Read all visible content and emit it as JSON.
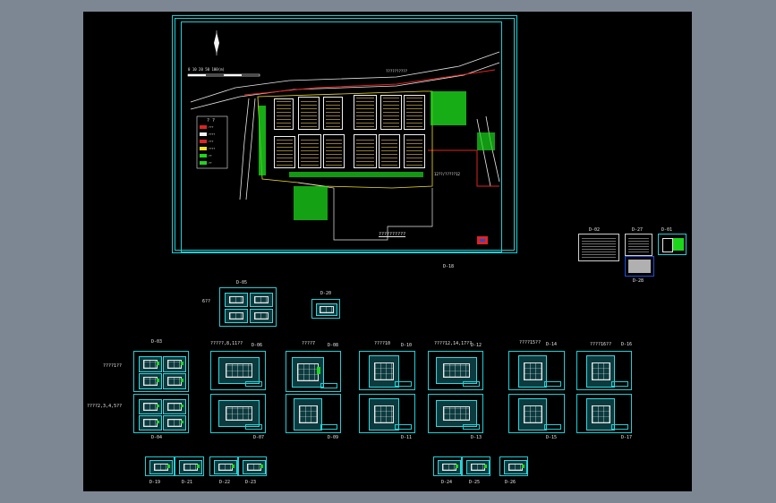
{
  "main_sheet": {
    "scale_label": "0 10 20       50        100(m)",
    "road_label": "??????????",
    "legend_title": "? ?",
    "legend_items": [
      "???",
      "????",
      "???",
      "????",
      "??",
      "??",
      "???"
    ],
    "road_label_bottom": "12??/?????12",
    "bottom_caption": "??????????",
    "sheet_code": "D-18"
  },
  "side_sheets": {
    "d02": "D-02",
    "d27": "D-27",
    "d01": "D-01",
    "d28": "D-28"
  },
  "mid_sheets": {
    "d05": "D-05",
    "d05_note": "6??",
    "d20": "D-20"
  },
  "row_labels": {
    "group1_note_a": "????1??",
    "group1_note_b": "????2,3,4,5??",
    "d03": "D-03",
    "d04": "D-04",
    "g2": "?????,8,11??",
    "d06": "D-06",
    "d07": "D-07",
    "g3": "????7",
    "d08": "D-08",
    "d09": "D-09",
    "g4": "????10",
    "d10": "D-10",
    "d11": "D-11",
    "g5": "????12,14,17??",
    "d12": "D-12",
    "d13": "D-13",
    "g6": "????15??",
    "d14": "D-14",
    "d15": "D-15",
    "g7": "????16??",
    "d16": "D-16",
    "d17": "D-17"
  },
  "bottom_labels": {
    "d19": "D-19",
    "d21": "D-21",
    "d22": "D-22",
    "d23": "D-23",
    "d24": "D-24",
    "d25": "D-25",
    "d26": "D-26"
  },
  "colors": {
    "background": "#7d8794",
    "canvas": "#000000",
    "sheet_border": "#1ecfd6",
    "road": "#e8e8e8",
    "red_line": "#e22222",
    "green": "#1bd81b",
    "building": "#e9c85a"
  }
}
